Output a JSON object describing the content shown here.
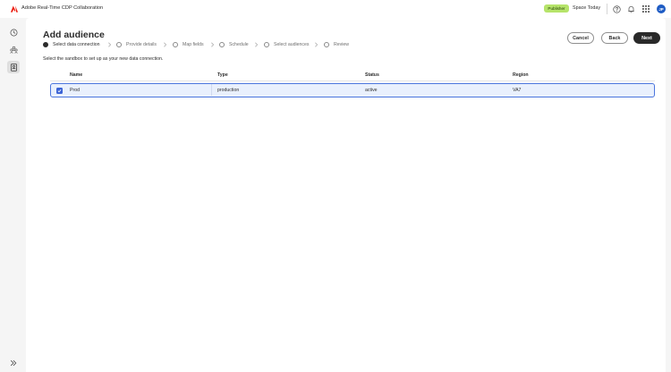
{
  "topbar": {
    "app_title": "Adobe Real-Time CDP Collaboration",
    "publisher_badge": "Publisher",
    "space_label": "Space Today",
    "avatar_initials": "JP",
    "icons": [
      "adobe-logo-icon",
      "help-icon",
      "bell-icon",
      "app-grid-icon"
    ]
  },
  "rail": {
    "icons": [
      "clock-icon",
      "group-icon",
      "audience-list-icon"
    ],
    "active_index": 2,
    "expand_icon": "double-chevron-right-icon"
  },
  "page": {
    "title": "Add audience",
    "instruction": "Select the sandbox to set up as your new data connection."
  },
  "stepper": {
    "current_index": 0,
    "steps": [
      {
        "label": "Select data connection"
      },
      {
        "label": "Provide details"
      },
      {
        "label": "Map fields"
      },
      {
        "label": "Schedule"
      },
      {
        "label": "Select audiences"
      },
      {
        "label": "Review"
      }
    ]
  },
  "actions": {
    "cancel": "Cancel",
    "back": "Back",
    "next": "Next"
  },
  "table": {
    "headers": [
      "Name",
      "Type",
      "Status",
      "Region"
    ],
    "rows": [
      {
        "name": "Prod",
        "type": "production",
        "status": "active",
        "region": "VA7",
        "selected": true
      }
    ]
  },
  "colors": {
    "accent": "#3b63d6",
    "selected_row_bg": "#e9f0fd",
    "publisher_badge": "#b6e46a",
    "primary_button": "#292929",
    "adobe_red": "#eb1000"
  }
}
